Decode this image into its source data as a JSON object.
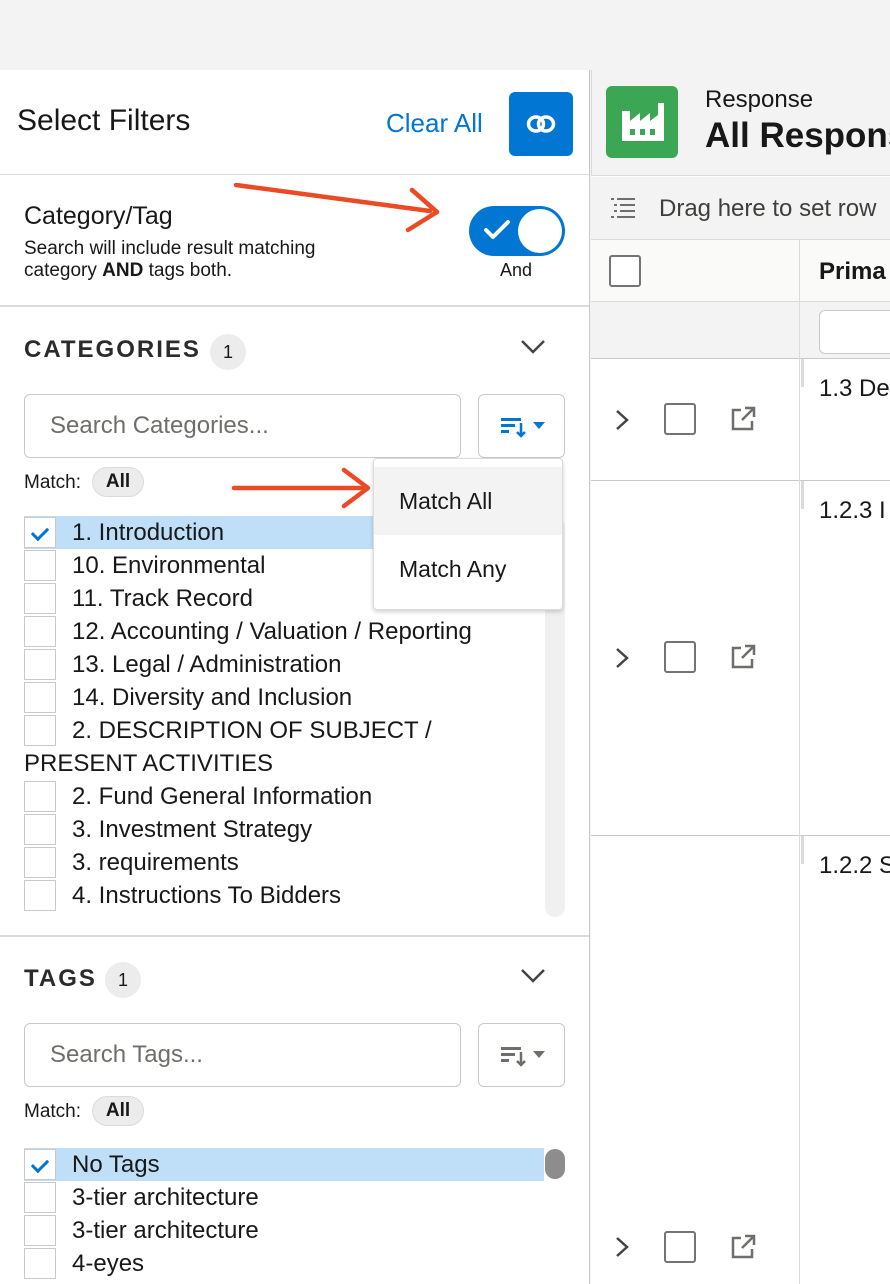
{
  "filters_panel": {
    "title": "Select Filters",
    "clear_all": "Clear All",
    "link_icon": "link-icon"
  },
  "category_tag": {
    "title": "Category/Tag",
    "desc_part1": "Search will include result matching category ",
    "desc_bold": "AND",
    "desc_part2": " tags both.",
    "toggle_state": "on",
    "toggle_label": "And"
  },
  "categories": {
    "title": "CATEGORIES",
    "count": "1",
    "search_placeholder": "Search Categories...",
    "match_label": "Match:",
    "match_value": "All",
    "items": [
      {
        "label": "1. Introduction",
        "checked": true
      },
      {
        "label": "10. Environmental",
        "checked": false
      },
      {
        "label": "11. Track Record",
        "checked": false
      },
      {
        "label": "12. Accounting / Valuation / Reporting",
        "checked": false
      },
      {
        "label": "13. Legal / Administration",
        "checked": false
      },
      {
        "label": "14. Diversity and Inclusion",
        "checked": false
      },
      {
        "label": "2. DESCRIPTION OF SUBJECT / PRESENT ACTIVITIES",
        "checked": false
      },
      {
        "label": "2. Fund General Information",
        "checked": false
      },
      {
        "label": "3. Investment Strategy",
        "checked": false
      },
      {
        "label": "3. requirements",
        "checked": false
      },
      {
        "label": "4. Instructions To Bidders",
        "checked": false
      }
    ]
  },
  "match_dropdown": {
    "options": [
      "Match All",
      "Match Any"
    ],
    "active": "Match All"
  },
  "tags": {
    "title": "TAGS",
    "count": "1",
    "search_placeholder": "Search Tags...",
    "match_label": "Match:",
    "match_value": "All",
    "items": [
      {
        "label": "No Tags",
        "checked": true
      },
      {
        "label": "3-tier architecture",
        "checked": false
      },
      {
        "label": "3-tier architecture",
        "checked": false
      },
      {
        "label": "4-eyes",
        "checked": false
      }
    ]
  },
  "response_view": {
    "object_label": "Response",
    "title": "All Respons",
    "group_hint": "Drag here to set row",
    "column_header": "Prima",
    "rows": [
      {
        "text": "1.3 De"
      },
      {
        "text": "1.2.3 I"
      },
      {
        "text": "1.2.2 S"
      }
    ]
  },
  "colors": {
    "brand_blue": "#0176d3",
    "app_icon_green": "#3ba755",
    "annotation_arrow": "#ea4b25",
    "selected_row": "#bfdff9"
  }
}
